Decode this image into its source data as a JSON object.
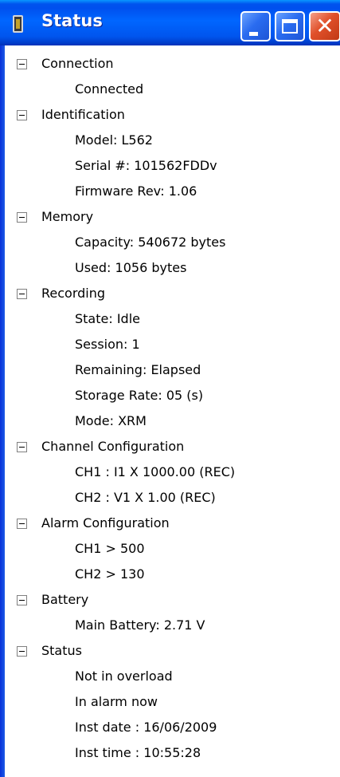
{
  "window": {
    "title": "Status",
    "close_glyph": "✕",
    "icon": "device-icon"
  },
  "tree": [
    {
      "label": "Connection",
      "items": [
        "Connected"
      ]
    },
    {
      "label": "Identification",
      "items": [
        "Model: L562",
        "Serial #: 101562FDDv",
        "Firmware Rev: 1.06"
      ]
    },
    {
      "label": "Memory",
      "items": [
        "Capacity: 540672 bytes",
        "Used: 1056 bytes"
      ]
    },
    {
      "label": "Recording",
      "items": [
        "State: Idle",
        "Session: 1",
        "Remaining: Elapsed",
        "Storage Rate: 05 (s)",
        "Mode: XRM"
      ]
    },
    {
      "label": "Channel Configuration",
      "items": [
        "CH1 :  I1 X 1000.00 (REC)",
        "CH2 :  V1 X 1.00 (REC)"
      ]
    },
    {
      "label": "Alarm Configuration",
      "items": [
        "CH1 > 500",
        "CH2 > 130"
      ]
    },
    {
      "label": "Battery",
      "items": [
        "Main Battery: 2.71 V"
      ]
    },
    {
      "label": "Status",
      "items": [
        "Not in overload",
        "In alarm now",
        "Inst date : 16/06/2009",
        "Inst time : 10:55:28"
      ]
    }
  ]
}
